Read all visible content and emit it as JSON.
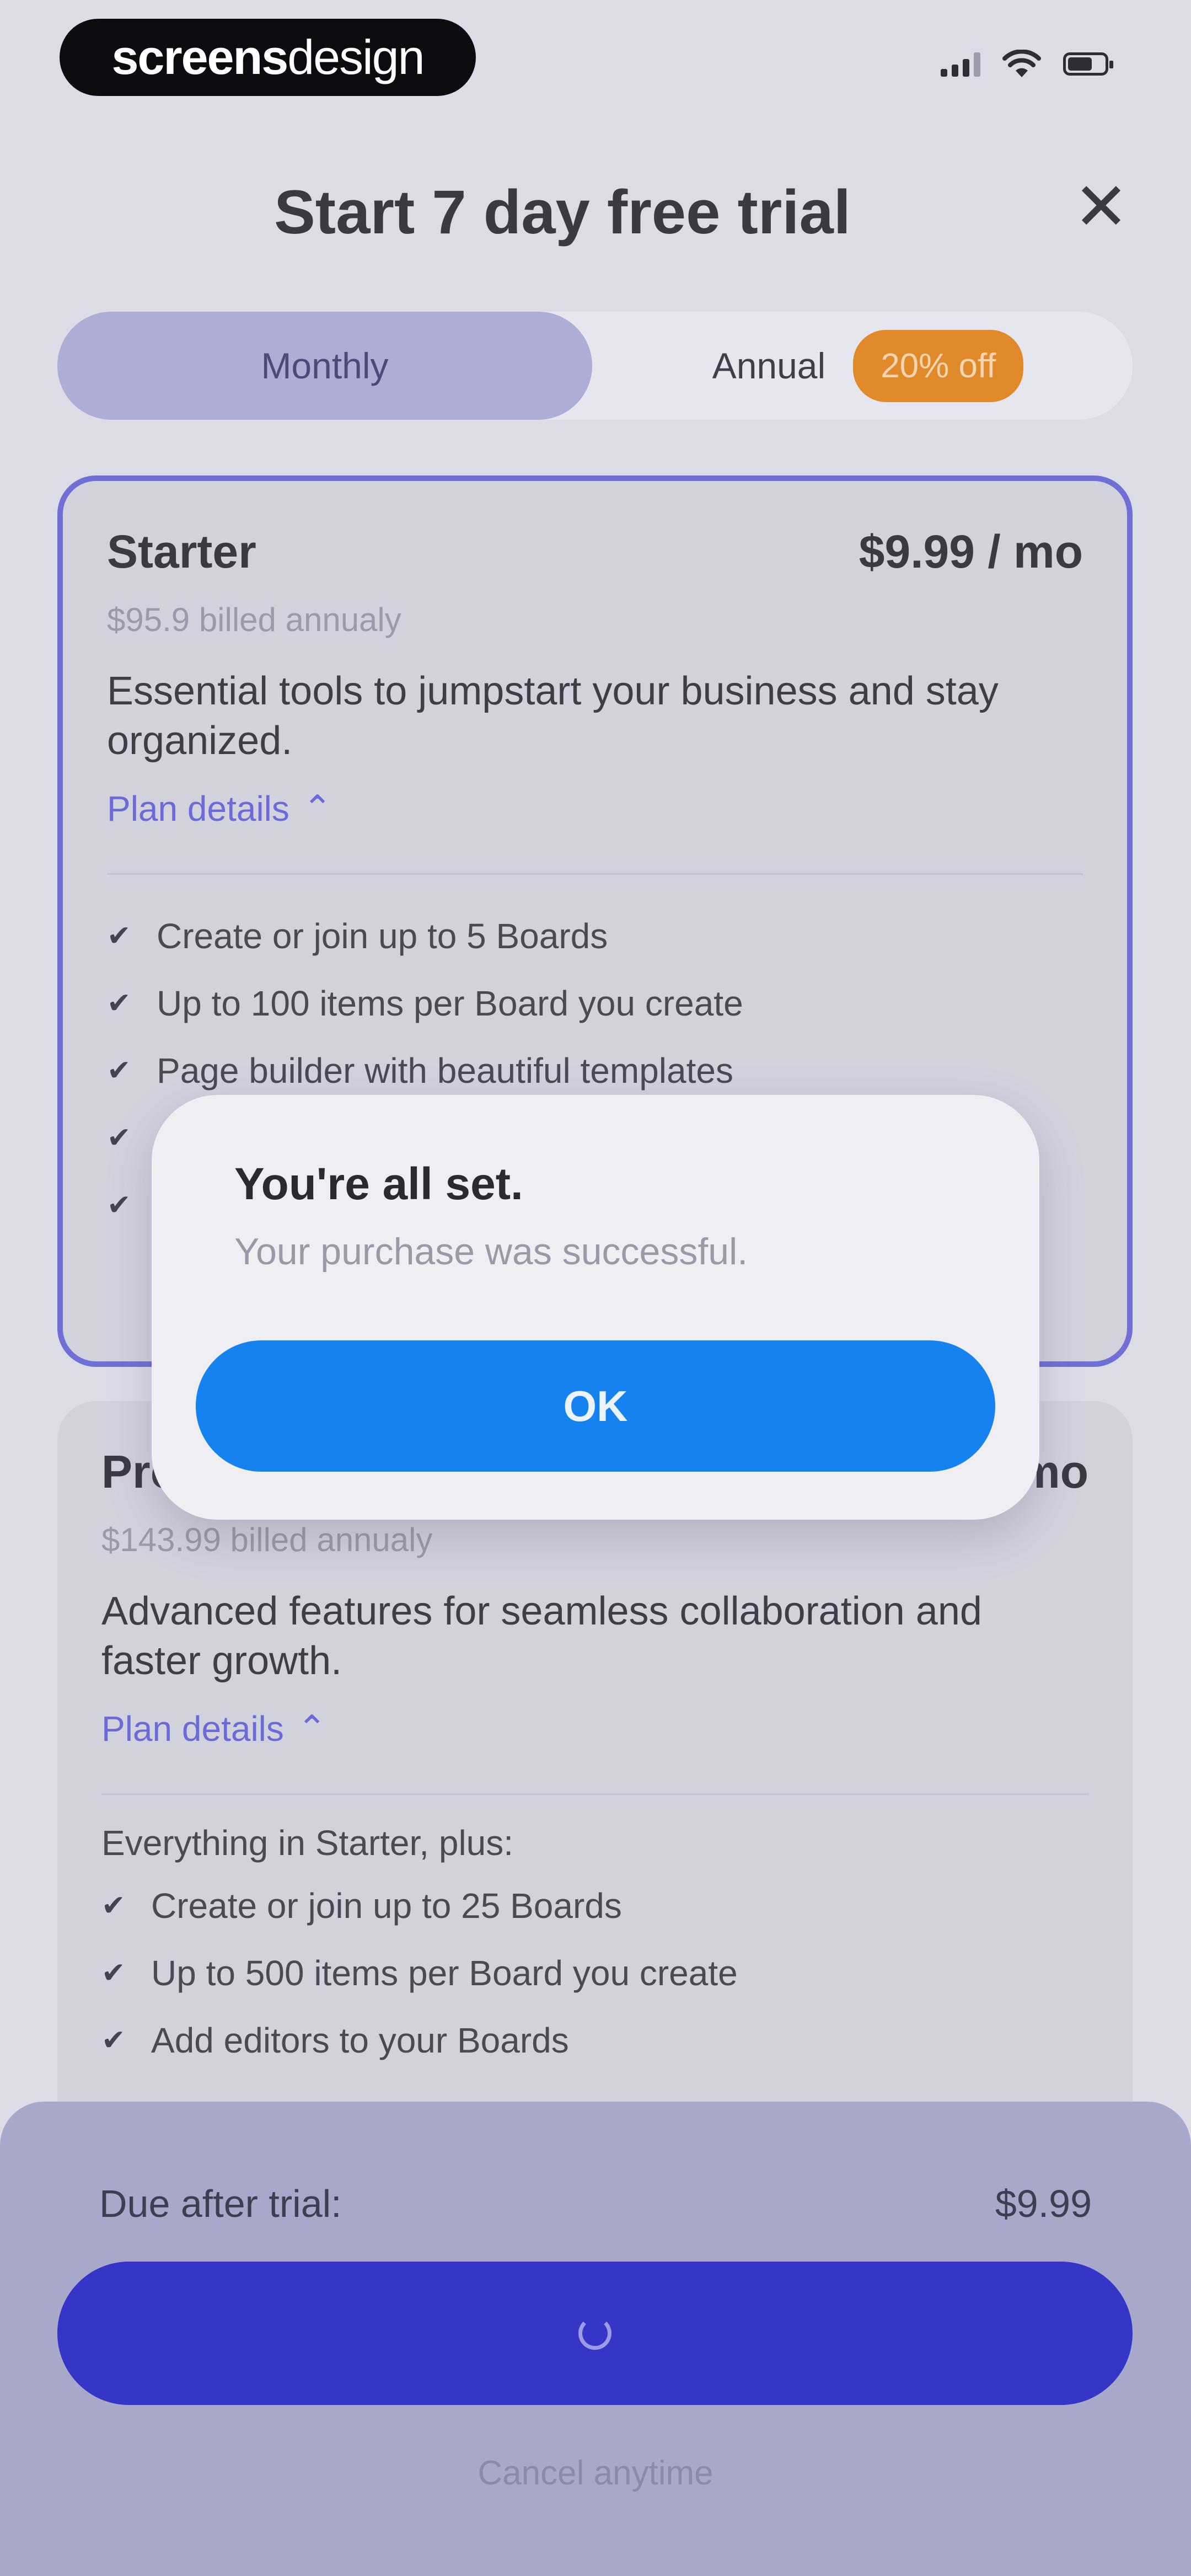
{
  "status_bar": {
    "brand_bold": "screens",
    "brand_light": "design"
  },
  "header": {
    "title": "Start 7 day free trial",
    "close_icon": "close-icon"
  },
  "billing_toggle": {
    "monthly_label": "Monthly",
    "annual_label": "Annual",
    "annual_badge": "20% off",
    "selected": "Monthly"
  },
  "plans": [
    {
      "name": "Starter",
      "price": "$9.99 / mo",
      "billed": "$95.9 billed annualy",
      "description": "Essential tools to jumpstart your business and stay organized.",
      "details_label": "Plan details",
      "selected": true,
      "features": [
        "Create or join up to 5 Boards",
        "Up to 100 items per Board you create",
        "Page builder with beautiful templates",
        "",
        ""
      ]
    },
    {
      "name": "Pro",
      "price": "mo",
      "billed": "$143.99 billed annualy",
      "description": "Advanced features for seamless collaboration and faster growth.",
      "details_label": "Plan details",
      "selected": false,
      "includes_label": "Everything in Starter, plus:",
      "features": [
        "Create or join up to 25 Boards",
        "Up to 500 items per Board you create",
        "Add editors to your Boards"
      ]
    }
  ],
  "footer": {
    "due_label": "Due after trial:",
    "due_value": "$9.99",
    "cancel_label": "Cancel anytime"
  },
  "dialog": {
    "title": "You're all set.",
    "message": "Your purchase was successful.",
    "ok_label": "OK"
  },
  "colors": {
    "accent": "#3535c8",
    "dialog_button": "#1682f0",
    "badge": "#e08a2c",
    "selected_border": "#6f6fd6"
  }
}
